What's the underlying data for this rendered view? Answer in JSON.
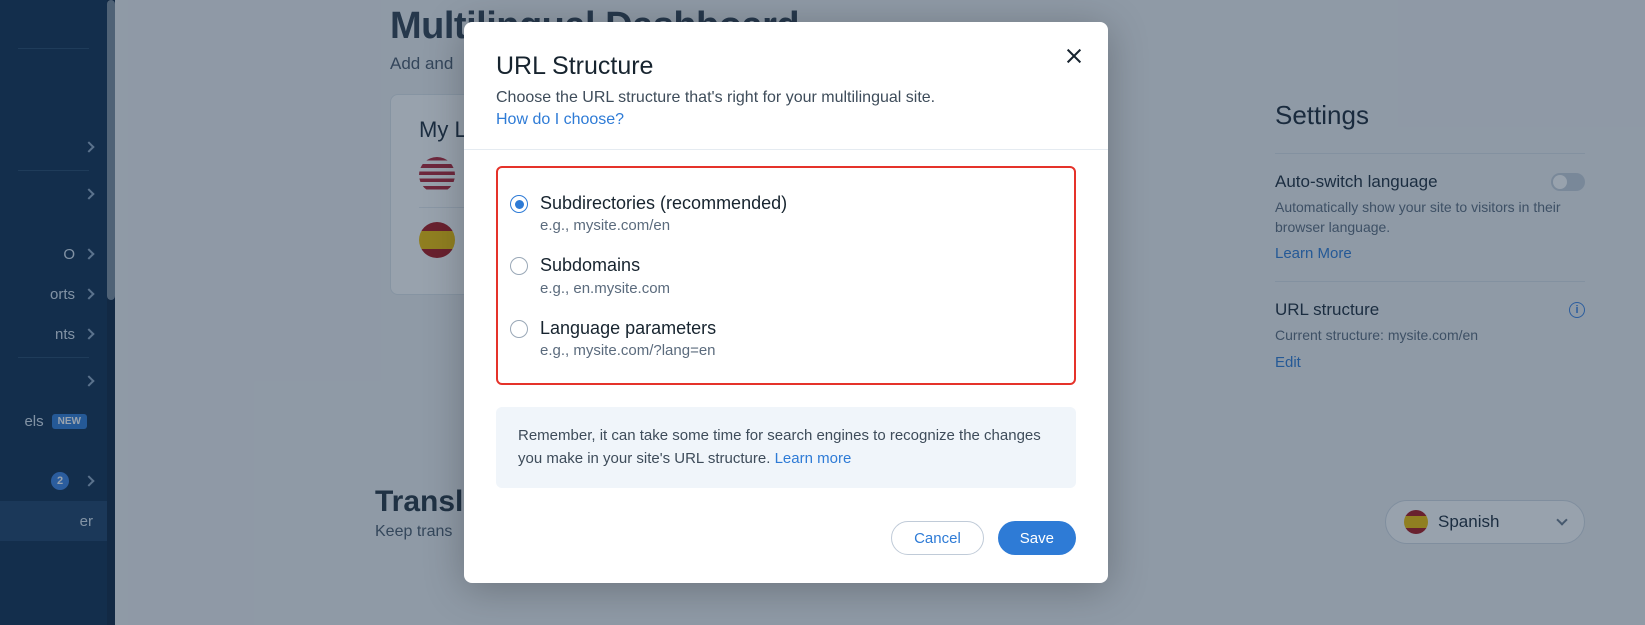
{
  "page": {
    "title": "Multilingual Dashboard",
    "subtitle": "Add and ",
    "my_languages": "My Languages"
  },
  "nav": {
    "items": [
      "",
      "",
      "O",
      "orts",
      "nts",
      "",
      "els",
      "",
      "er"
    ],
    "badge_new": "NEW",
    "count": "2"
  },
  "settings": {
    "title": "Settings",
    "auto_switch": {
      "label": "Auto-switch language",
      "desc": "Automatically show your site to visitors in their browser language.",
      "learn_more": "Learn More"
    },
    "url_structure": {
      "label": "URL structure",
      "current": "Current structure: mysite.com/en",
      "edit": "Edit"
    }
  },
  "translate": {
    "title": "Transla",
    "subtitle": "Keep trans",
    "selected_lang": "Spanish"
  },
  "modal": {
    "title": "URL Structure",
    "subtitle": "Choose the URL structure that's right for your multilingual site.",
    "help_link": "How do I choose?",
    "options": [
      {
        "label": "Subdirectories (recommended)",
        "eg": "e.g., mysite.com/en",
        "selected": true
      },
      {
        "label": "Subdomains",
        "eg": "e.g., en.mysite.com",
        "selected": false
      },
      {
        "label": "Language parameters",
        "eg": "e.g., mysite.com/?lang=en",
        "selected": false
      }
    ],
    "info": "Remember, it can take some time for search engines to recognize the changes you make in your site's URL structure. ",
    "info_link": "Learn more",
    "cancel": "Cancel",
    "save": "Save"
  }
}
